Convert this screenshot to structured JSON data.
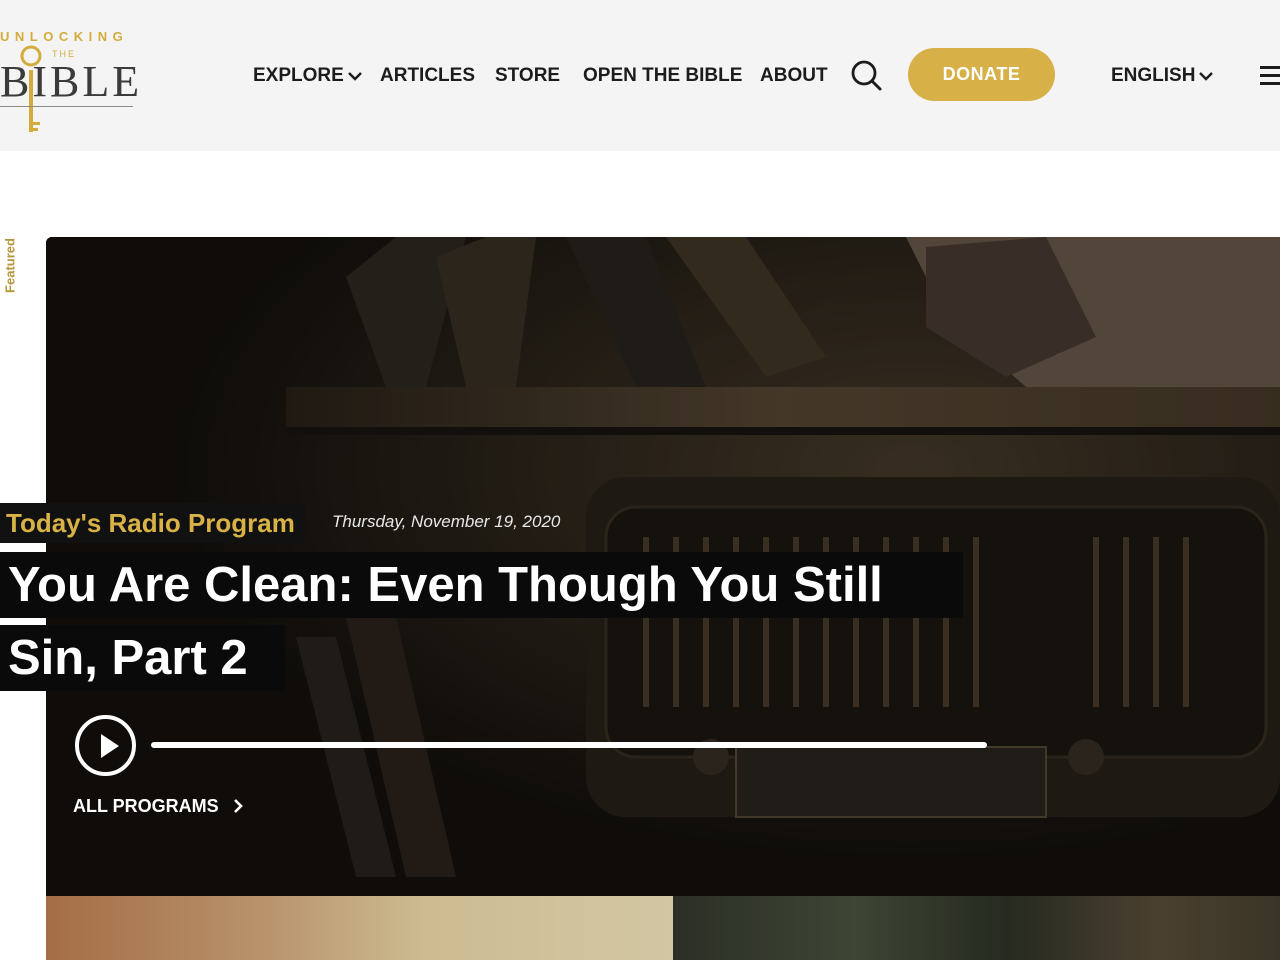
{
  "logo": {
    "line1": "UNLOCKING",
    "line2": "THE",
    "line3": "BIBLE"
  },
  "nav": {
    "items": [
      {
        "label": "EXPLORE",
        "has_dropdown": true
      },
      {
        "label": "ARTICLES"
      },
      {
        "label": "STORE"
      },
      {
        "label": "OPEN THE BIBLE"
      },
      {
        "label": "ABOUT"
      }
    ],
    "search_icon": "search-icon",
    "donate_label": "DONATE",
    "language_label": "ENGLISH",
    "menu_icon": "hamburger-menu-icon"
  },
  "featured_label": "Featured",
  "hero": {
    "tag": "Today's Radio Program",
    "date": "Thursday, November 19, 2020",
    "title_line1": "You Are Clean: Even Though You Still",
    "title_line2": "Sin, Part 2",
    "player": {
      "play_icon": "play-icon",
      "progress": 0
    },
    "all_programs_label": "ALL PROGRAMS"
  },
  "colors": {
    "accent": "#d8b048",
    "header_bg": "#f4f4f4",
    "hero_bg": "#1d1812"
  }
}
